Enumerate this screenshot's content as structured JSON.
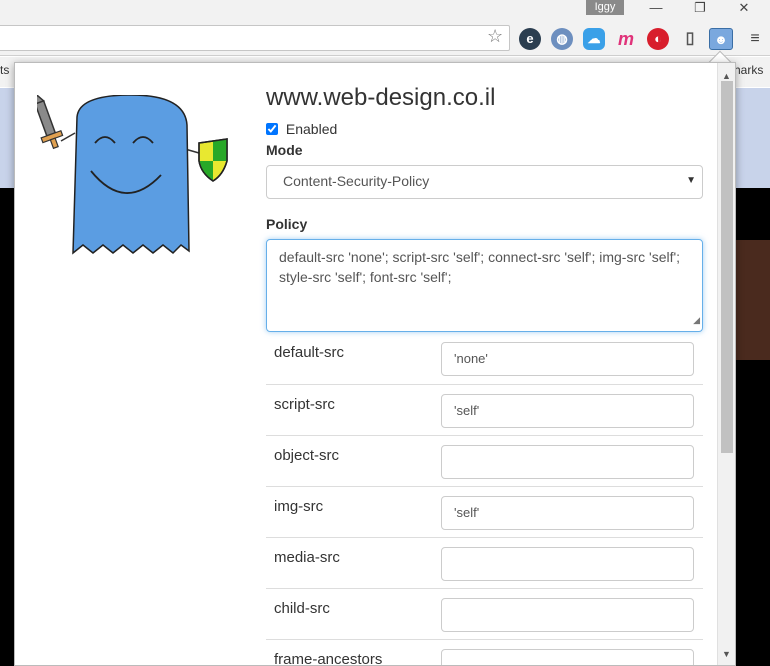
{
  "browser": {
    "user_name": "Iggy",
    "window_buttons": [
      "—",
      "❐",
      "✕"
    ],
    "bookmarks_left": "ts",
    "bookmarks_right": "harks"
  },
  "popup": {
    "site": "www.web-design.co.il",
    "enabled_label": "Enabled",
    "enabled": true,
    "mode_label": "Mode",
    "mode_value": "Content-Security-Policy",
    "policy_label": "Policy",
    "policy_text": "default-src 'none'; script-src 'self'; connect-src 'self'; img-src 'self'; style-src 'self'; font-src 'self';",
    "directives": [
      {
        "name": "default-src",
        "value": "'none'"
      },
      {
        "name": "script-src",
        "value": "'self'"
      },
      {
        "name": "object-src",
        "value": ""
      },
      {
        "name": "img-src",
        "value": "'self'"
      },
      {
        "name": "media-src",
        "value": ""
      },
      {
        "name": "child-src",
        "value": ""
      },
      {
        "name": "frame-ancestors",
        "value": ""
      }
    ]
  },
  "colors": {
    "mascot_body": "#5b9de2",
    "accent_focus": "#66afe9"
  }
}
